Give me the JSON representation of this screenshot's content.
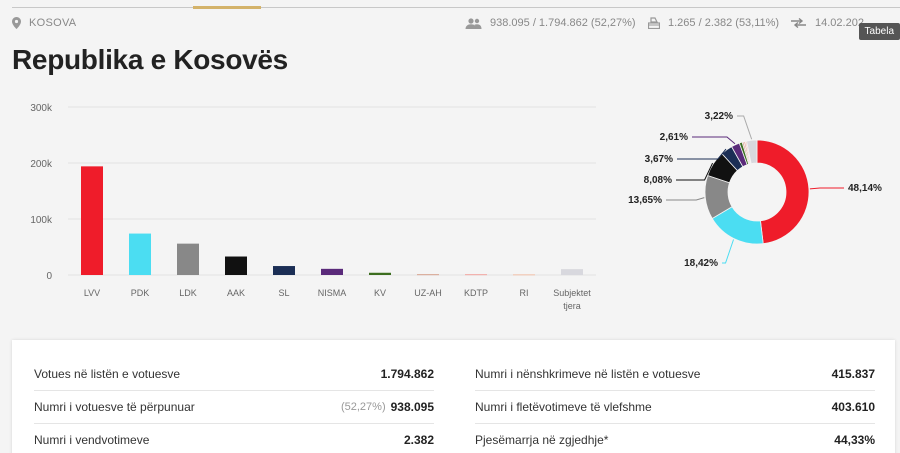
{
  "header": {
    "location": "KOSOVA",
    "voters_stat": "938.095 / 1.794.862 (52,27%)",
    "stations_stat": "1.265 / 2.382 (53,11%)",
    "date_stat": "14.02.202",
    "tabela_label": "Tabela",
    "title": "Republika e Kosovës"
  },
  "icons": {
    "location": "map-pin-icon",
    "voters": "people-icon",
    "stations": "ballot-box-icon",
    "date": "swap-arrows-icon"
  },
  "chart_data": [
    {
      "type": "bar",
      "categories": [
        "LVV",
        "PDK",
        "LDK",
        "AAK",
        "SL",
        "NISMA",
        "KV",
        "UZ-AH",
        "KDTP",
        "RI",
        "Subjektet tjera"
      ],
      "values": [
        194000,
        74000,
        56000,
        33000,
        16000,
        11000,
        4000,
        1500,
        1500,
        1200,
        10500
      ],
      "colors": [
        "#ef1c2a",
        "#4bddf2",
        "#888888",
        "#111111",
        "#1b2e55",
        "#5a2a7a",
        "#3c6e1f",
        "#d6a38f",
        "#f2a6a0",
        "#f0c0a8",
        "#d8d8de"
      ],
      "yticks": [
        "0",
        "100k",
        "200k",
        "300k"
      ],
      "ylim": [
        0,
        300000
      ],
      "grid": true
    },
    {
      "type": "pie",
      "labels": [
        "LVV",
        "PDK",
        "LDK",
        "AAK",
        "SL",
        "NISMA",
        "KV",
        "UZ-AH",
        "KDTP",
        "RI",
        "Subjektet tjera"
      ],
      "values": [
        48.14,
        18.42,
        13.65,
        8.08,
        3.67,
        2.61,
        0.9,
        0.5,
        0.5,
        0.4,
        3.22
      ],
      "colors": [
        "#ef1c2a",
        "#4bddf2",
        "#888888",
        "#111111",
        "#1b2e55",
        "#5a2a7a",
        "#3c6e1f",
        "#d6a38f",
        "#f2a6a0",
        "#f0c0a8",
        "#d8d8de"
      ],
      "data_labels": [
        "48,14%",
        "18,42%",
        "13,65%",
        "8,08%",
        "3,67%",
        "2,61%",
        "",
        "",
        "",
        "",
        "3,22%"
      ]
    }
  ],
  "stats": {
    "left": [
      {
        "label": "Votues në listën e votuesve",
        "pct": "",
        "value": "1.794.862"
      },
      {
        "label": "Numri i votuesve të përpunuar",
        "pct": "(52,27%)",
        "value": "938.095"
      },
      {
        "label": "Numri i vendvotimeve",
        "pct": "",
        "value": "2.382"
      }
    ],
    "right": [
      {
        "label": "Numri i nënshkrimeve në listën e votuesve",
        "value": "415.837"
      },
      {
        "label": "Numri i fletëvotimeve të vlefshme",
        "value": "403.610"
      },
      {
        "label": "Pjesëmarrja në zgjedhje*",
        "value": "44,33%"
      }
    ]
  }
}
